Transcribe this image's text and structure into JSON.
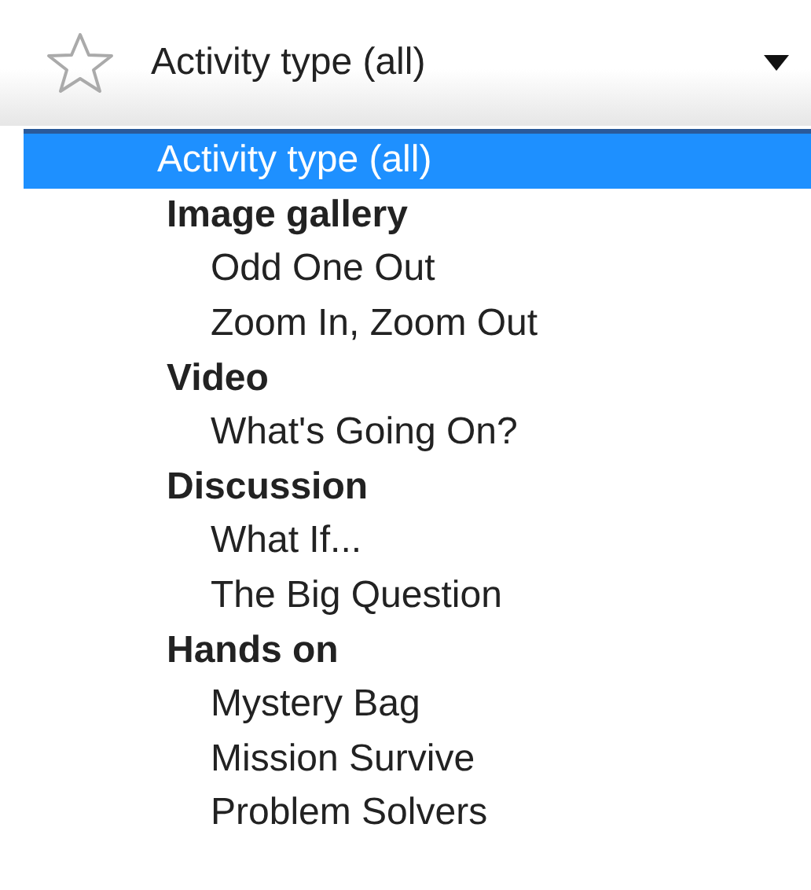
{
  "select": {
    "value": "Activity type (all)",
    "expanded": true
  },
  "options": [
    {
      "kind": "option",
      "label": "Activity type (all)",
      "selected": true
    },
    {
      "kind": "group",
      "label": "Image gallery",
      "children": [
        {
          "label": "Odd One Out",
          "selected": false
        },
        {
          "label": "Zoom In, Zoom Out",
          "selected": false
        }
      ]
    },
    {
      "kind": "group",
      "label": "Video",
      "children": [
        {
          "label": "What's Going On?",
          "selected": false
        }
      ]
    },
    {
      "kind": "group",
      "label": "Discussion",
      "children": [
        {
          "label": "What If...",
          "selected": false
        },
        {
          "label": "The Big Question",
          "selected": false
        }
      ]
    },
    {
      "kind": "group",
      "label": "Hands on",
      "children": [
        {
          "label": "Mystery Bag",
          "selected": false
        },
        {
          "label": "Mission Survive",
          "selected": false
        },
        {
          "label": "Problem Solvers",
          "selected": false
        }
      ]
    }
  ]
}
